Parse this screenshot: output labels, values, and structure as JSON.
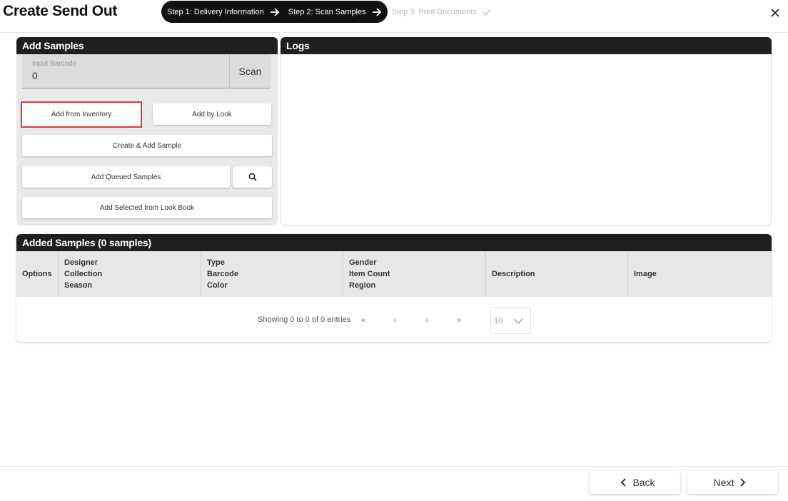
{
  "header": {
    "title": "Create Send Out",
    "steps": [
      {
        "label": "Step 1: Delivery Information",
        "state": "done"
      },
      {
        "label": "Step 2: Scan Samples",
        "state": "current"
      },
      {
        "label": "Step 3: Print Documents",
        "state": "pending"
      }
    ],
    "close_icon": "close-icon"
  },
  "add_samples": {
    "title": "Add Samples",
    "barcode_label": "Input Barcode",
    "barcode_value": "0",
    "scan_label": "Scan",
    "add_from_inventory": "Add from Inventory",
    "add_by_look": "Add by Look",
    "create_and_add": "Create & Add Sample",
    "add_queued": "Add Queued Samples",
    "search_icon": "search-icon",
    "add_from_lookbook": "Add Selected from Look Book"
  },
  "logs": {
    "title": "Logs"
  },
  "added_samples": {
    "title": "Added Samples (0 samples)",
    "columns": [
      {
        "lines": [
          "Options"
        ]
      },
      {
        "lines": [
          "Designer",
          "Collection",
          "Season"
        ]
      },
      {
        "lines": [
          "Type",
          "Barcode",
          "Color"
        ]
      },
      {
        "lines": [
          "Gender",
          "Item Count",
          "Region"
        ]
      },
      {
        "lines": [
          "Description"
        ]
      },
      {
        "lines": [
          "Image"
        ]
      }
    ],
    "pagination": {
      "info": "Showing 0 to 0 of 0 entries",
      "first": "«",
      "prev": "‹",
      "next": "›",
      "last": "»",
      "per_page": "10"
    }
  },
  "footer": {
    "back_label": "Back",
    "next_label": "Next"
  },
  "colors": {
    "dark": "#1f1f1f",
    "highlight": "#e53935",
    "panel_bg": "#e9e9e9"
  }
}
